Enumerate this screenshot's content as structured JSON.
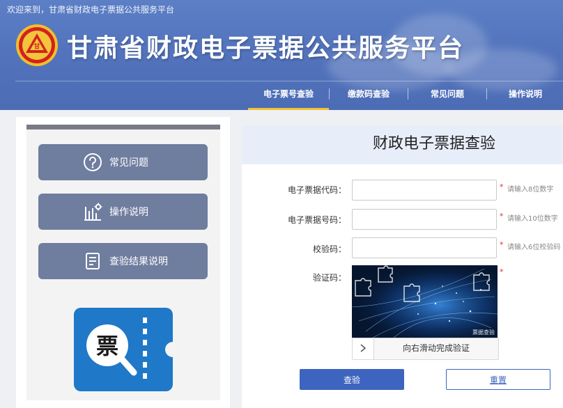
{
  "header": {
    "welcome": "欢迎来到，甘肃省财政电子票据公共服务平台",
    "title": "甘肃省财政电子票据公共服务平台",
    "emblem_text": "甘",
    "nav": [
      {
        "label": "电子票号查验",
        "active": true
      },
      {
        "label": "缴款码查验",
        "active": false
      },
      {
        "label": "常见问题",
        "active": false
      },
      {
        "label": "操作说明",
        "active": false
      }
    ]
  },
  "sidebar": {
    "items": [
      {
        "label": "常见问题",
        "icon": "question-circle-icon"
      },
      {
        "label": "操作说明",
        "icon": "chart-gear-icon"
      },
      {
        "label": "查验结果说明",
        "icon": "document-icon"
      }
    ],
    "logo_text": "票"
  },
  "form": {
    "title": "财政电子票据查验",
    "fields": [
      {
        "label": "电子票据代码：",
        "value": "",
        "hint": "请输入8位数字"
      },
      {
        "label": "电子票据号码：",
        "value": "",
        "hint": "请输入10位数字"
      },
      {
        "label": "校验码：",
        "value": "",
        "hint": "请输入6位校验码"
      }
    ],
    "captcha_label": "验证码：",
    "captcha_caption": "票据查验",
    "slider_text": "向右滑动完成验证",
    "required_mark": "*",
    "submit_label": "查验",
    "reset_label": "重置"
  },
  "colors": {
    "header_blue": "#5374bd",
    "nav_active_underline": "#f1c232",
    "sidebar_button": "#6f7d9f",
    "primary_button": "#3d64bf",
    "required_red": "#d9312b"
  }
}
